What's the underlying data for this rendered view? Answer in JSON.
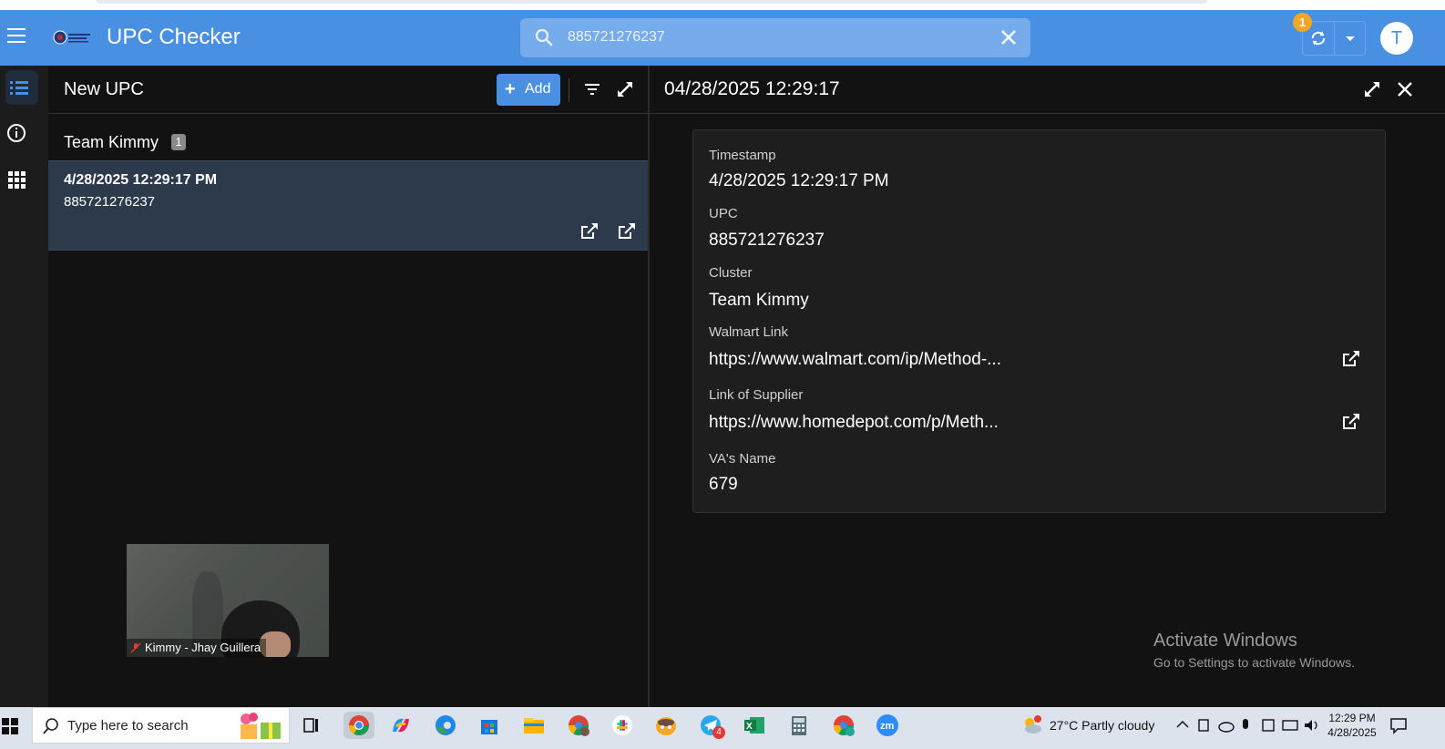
{
  "app": {
    "title": "UPC Checker",
    "accent_color": "#4a90e2"
  },
  "search": {
    "value": "885721276237",
    "placeholder": "Search"
  },
  "header": {
    "sync_badge": "1",
    "avatar_initial": "T"
  },
  "rail": {
    "items": [
      {
        "icon": "list-icon",
        "active": true
      },
      {
        "icon": "info-icon",
        "active": false
      },
      {
        "icon": "apps-grid-icon",
        "active": false
      }
    ]
  },
  "list_panel": {
    "title": "New UPC",
    "add_label": "Add",
    "group": {
      "title": "Team Kimmy",
      "count": "1"
    },
    "rows": [
      {
        "timestamp": "4/28/2025 12:29:17 PM",
        "upc": "885721276237"
      }
    ]
  },
  "detail_panel": {
    "title": "04/28/2025 12:29:17",
    "fields": [
      {
        "label": "Timestamp",
        "value": "4/28/2025 12:29:17 PM"
      },
      {
        "label": "UPC",
        "value": "885721276237"
      },
      {
        "label": "Cluster",
        "value": "Team Kimmy"
      },
      {
        "label": "Walmart Link",
        "value": "https://www.walmart.com/ip/Method-..."
      },
      {
        "label": "Link of Supplier",
        "value": "https://www.homedepot.com/p/Meth..."
      },
      {
        "label": "VA's Name",
        "value": "679"
      }
    ]
  },
  "video_overlay": {
    "name": "Kimmy - Jhay Guillera"
  },
  "watermark": {
    "line1": "Activate Windows",
    "line2": "Go to Settings to activate Windows."
  },
  "taskbar": {
    "search_placeholder": "Type here to search",
    "weather": "27°C  Partly cloudy",
    "time": "12:29 PM",
    "date": "4/28/2025",
    "telegram_badge": "4"
  }
}
